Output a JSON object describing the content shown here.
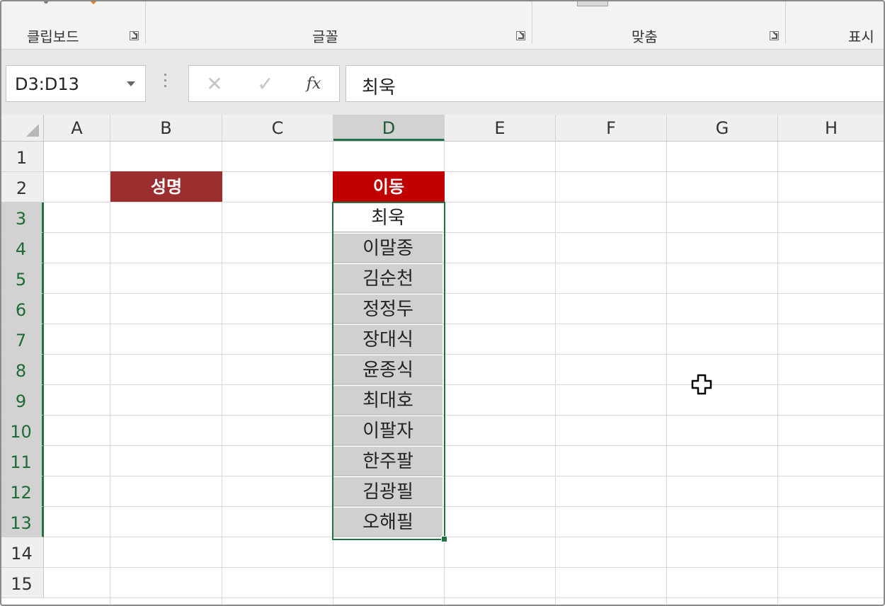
{
  "ribbon": {
    "groups": [
      {
        "label": "클립보드"
      },
      {
        "label": "글꼴"
      },
      {
        "label": "맞춤"
      },
      {
        "label": "표시"
      }
    ]
  },
  "formula_bar": {
    "name_box": "D3:D13",
    "cancel_glyph": "✕",
    "enter_glyph": "✓",
    "fx_glyph": "fx",
    "content": "최욱"
  },
  "sheet": {
    "columns": [
      "A",
      "B",
      "C",
      "D",
      "E",
      "F",
      "G",
      "H"
    ],
    "selected_column": "D",
    "rows": [
      "1",
      "2",
      "3",
      "4",
      "5",
      "6",
      "7",
      "8",
      "9",
      "10",
      "11",
      "12",
      "13",
      "14",
      "15"
    ],
    "selected_rows": [
      "3",
      "4",
      "5",
      "6",
      "7",
      "8",
      "9",
      "10",
      "11",
      "12",
      "13"
    ],
    "header_b": "성명",
    "header_d": "이동",
    "header_b_color": "#9b2f2f",
    "header_d_color": "#c00000",
    "selection_color": "#217346",
    "d_values": [
      "최욱",
      "이말종",
      "김순천",
      "정정두",
      "장대식",
      "윤종식",
      "최대호",
      "이팔자",
      "한주팔",
      "김광필",
      "오해필"
    ],
    "active_cell": "D3"
  },
  "cursor": {
    "icon": "excel-white-cross-cursor"
  }
}
